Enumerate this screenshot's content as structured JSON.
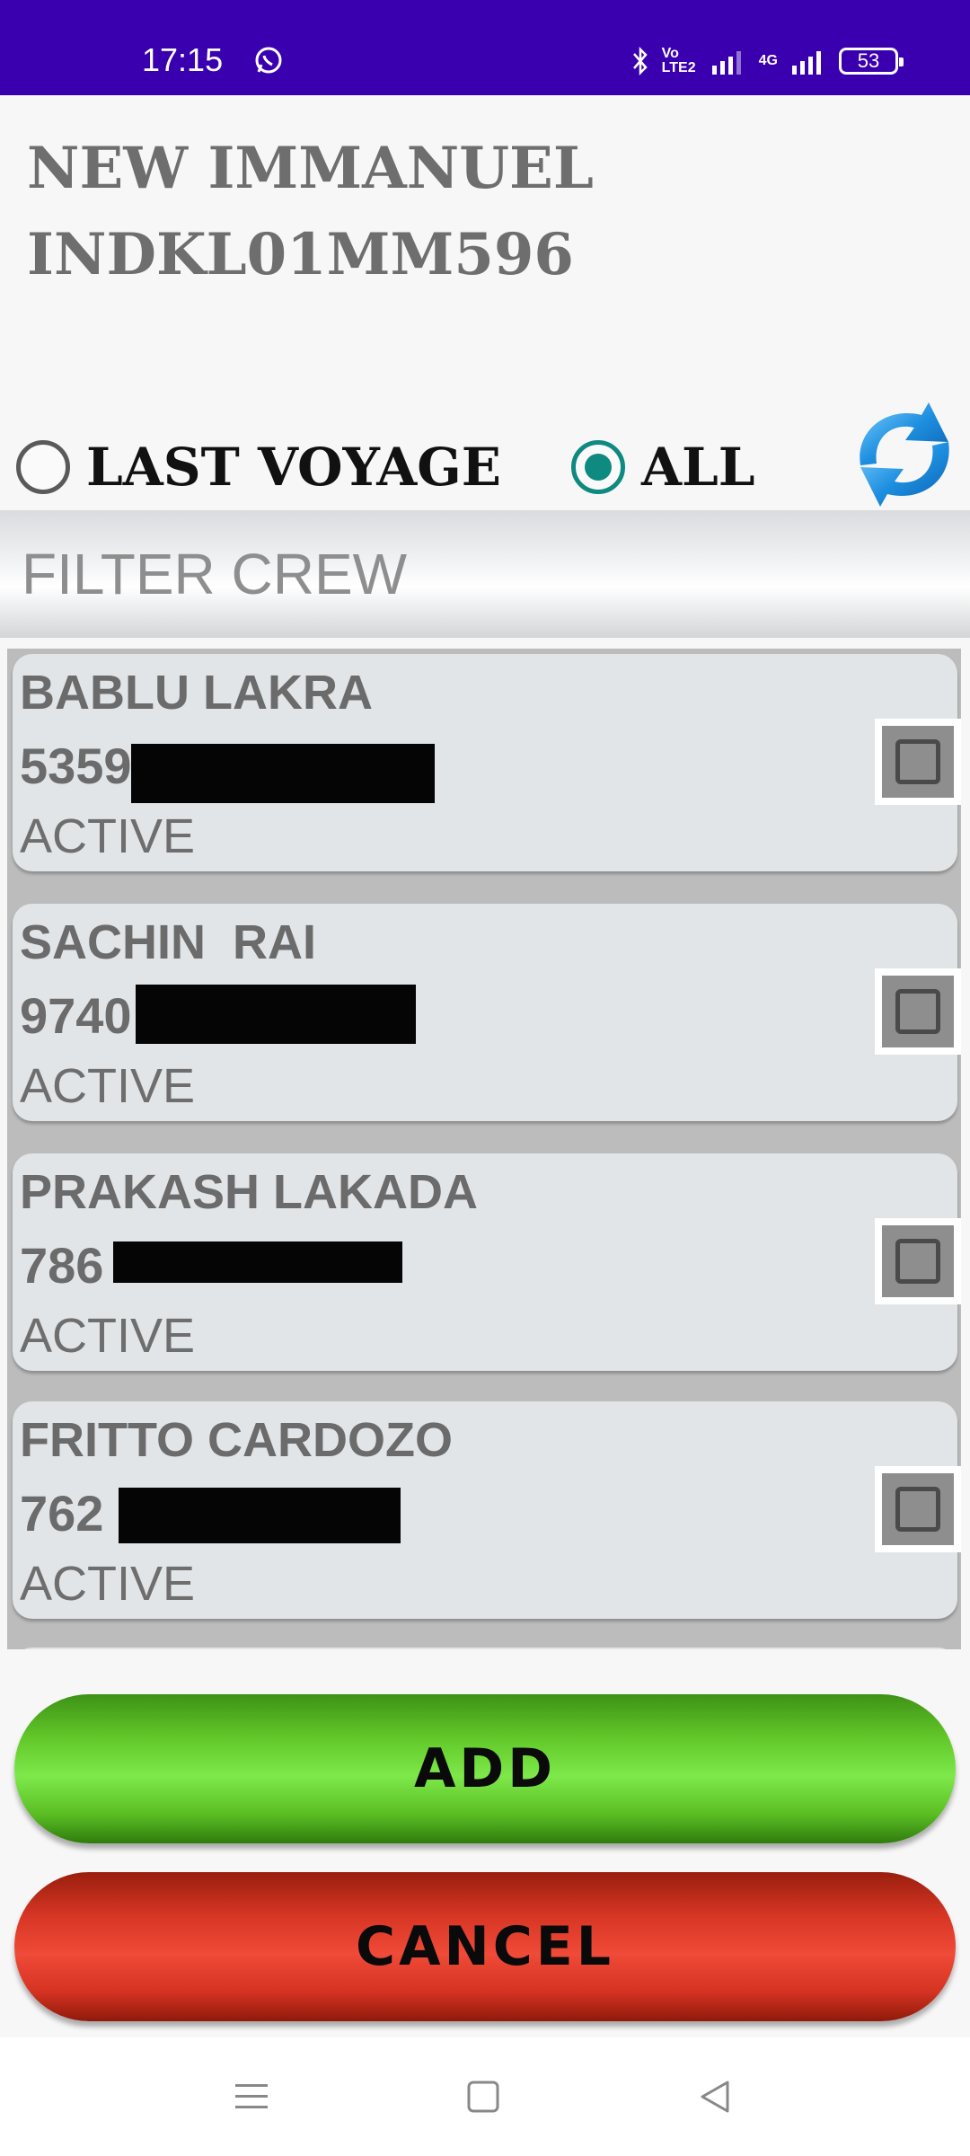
{
  "status_bar": {
    "time": "17:15",
    "volte_label": "Vo LTE2",
    "network_label": "4G",
    "battery": "53",
    "icons": [
      "whatsapp-icon",
      "bluetooth-icon",
      "volte-icon",
      "signal-icon",
      "signal-4g-icon",
      "battery-icon"
    ]
  },
  "header": {
    "vessel_name": "NEW IMMANUEL",
    "vessel_reg": "INDKL01MM596"
  },
  "radio_group": {
    "options": [
      {
        "label": "LAST VOYAGE",
        "checked": false
      },
      {
        "label": "ALL",
        "checked": true
      }
    ],
    "refresh_icon": "refresh-icon"
  },
  "filter": {
    "placeholder": "FILTER CREW"
  },
  "crew": [
    {
      "name": "BABLU LAKRA",
      "phone": "5359",
      "status": "ACTIVE",
      "checked": false
    },
    {
      "name": "SACHIN  RAI",
      "phone": "9740",
      "status": "ACTIVE",
      "checked": false
    },
    {
      "name": "PRAKASH LAKADA",
      "phone": "786",
      "status": "ACTIVE",
      "checked": false
    },
    {
      "name": "FRITTO CARDOZO",
      "phone": "762",
      "status": "ACTIVE",
      "checked": false
    }
  ],
  "actions": {
    "add_label": "ADD",
    "cancel_label": "CANCEL"
  },
  "nav_bar": {
    "icons": [
      "menu-icon",
      "home-icon",
      "back-icon"
    ]
  },
  "colors": {
    "status_bar": "#3a00b0",
    "radio_accent": "#0e8a80",
    "add_button": "#63c92a",
    "cancel_button": "#f04a38"
  }
}
